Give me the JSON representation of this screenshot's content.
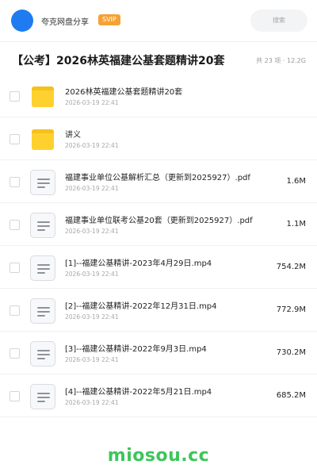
{
  "header": {
    "username": "夸克网盘分享",
    "badge": "SVIP",
    "search_placeholder": "搜索"
  },
  "folder": {
    "title": "【公考】2026林英福建公基套题精讲20套",
    "summary": "共 23 项 · 12.2G"
  },
  "items": [
    {
      "type": "folder",
      "name": "2026林英福建公基套题精讲20套",
      "date": "2026-03-19 22:41",
      "size": ""
    },
    {
      "type": "folder",
      "name": "讲义",
      "date": "2026-03-19 22:41",
      "size": ""
    },
    {
      "type": "doc",
      "name": "福建事业单位公基解析汇总（更新到2025927）.pdf",
      "date": "2026-03-19 22:41",
      "size": "1.6M"
    },
    {
      "type": "doc",
      "name": "福建事业单位联考公基20套（更新到2025927）.pdf",
      "date": "2026-03-19 22:41",
      "size": "1.1M"
    },
    {
      "type": "doc",
      "name": "[1]--福建公基精讲-2023年4月29日.mp4",
      "date": "2026-03-19 22:41",
      "size": "754.2M"
    },
    {
      "type": "doc",
      "name": "[2]--福建公基精讲-2022年12月31日.mp4",
      "date": "2026-03-19 22:41",
      "size": "772.9M"
    },
    {
      "type": "doc",
      "name": "[3]--福建公基精讲-2022年9月3日.mp4",
      "date": "2026-03-19 22:41",
      "size": "730.2M"
    },
    {
      "type": "doc",
      "name": "[4]--福建公基精讲-2022年5月21日.mp4",
      "date": "2026-03-19 22:41",
      "size": "685.2M"
    }
  ],
  "icons": {
    "folder": "folder-icon",
    "doc": "document-icon"
  },
  "colors": {
    "avatar": "#1e7cf0",
    "badge": "#f4a236",
    "folder": "#ffd12e",
    "watermark": "#3cc65a"
  },
  "watermark": "miosou.cc"
}
